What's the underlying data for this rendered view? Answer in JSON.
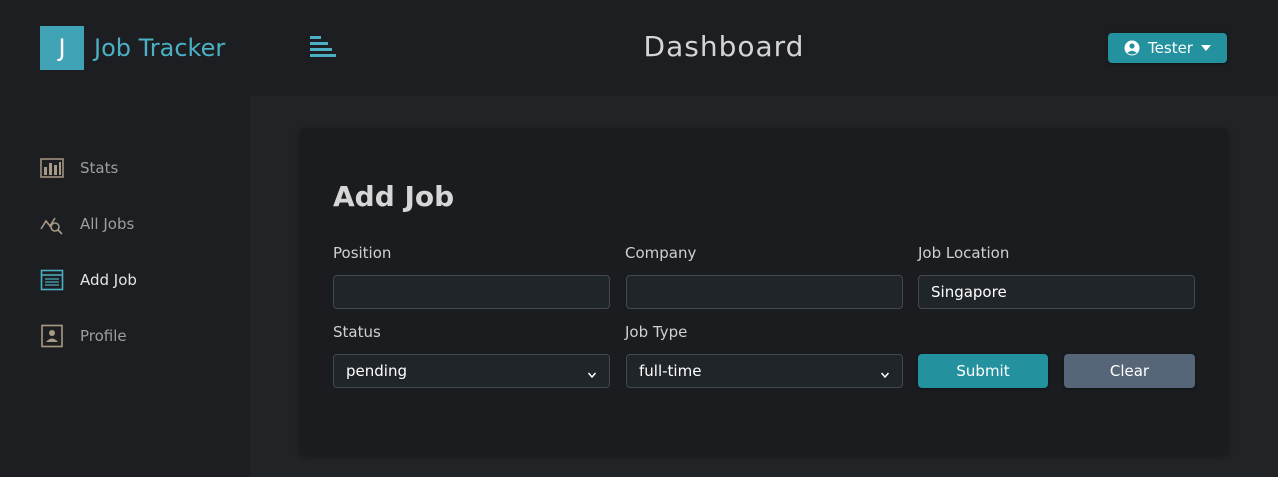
{
  "brand": {
    "logo_letter": "J",
    "name": "Job Tracker"
  },
  "header": {
    "title": "Dashboard",
    "user_label": "Tester"
  },
  "sidebar": {
    "items": [
      {
        "label": "Stats",
        "icon": "bar-chart-icon",
        "active": false
      },
      {
        "label": "All Jobs",
        "icon": "job-search-icon",
        "active": false
      },
      {
        "label": "Add Job",
        "icon": "form-icon",
        "active": true
      },
      {
        "label": "Profile",
        "icon": "id-card-icon",
        "active": false
      }
    ]
  },
  "form": {
    "title": "Add Job",
    "position": {
      "label": "Position",
      "value": ""
    },
    "company": {
      "label": "Company",
      "value": ""
    },
    "location": {
      "label": "Job Location",
      "value": "Singapore"
    },
    "status": {
      "label": "Status",
      "value": "pending"
    },
    "job_type": {
      "label": "Job Type",
      "value": "full-time"
    },
    "submit_label": "Submit",
    "clear_label": "Clear"
  },
  "colors": {
    "accent": "#23929e",
    "brand_text": "#4bb0c4",
    "clear_button": "#566678",
    "background": "#1b1d20"
  }
}
